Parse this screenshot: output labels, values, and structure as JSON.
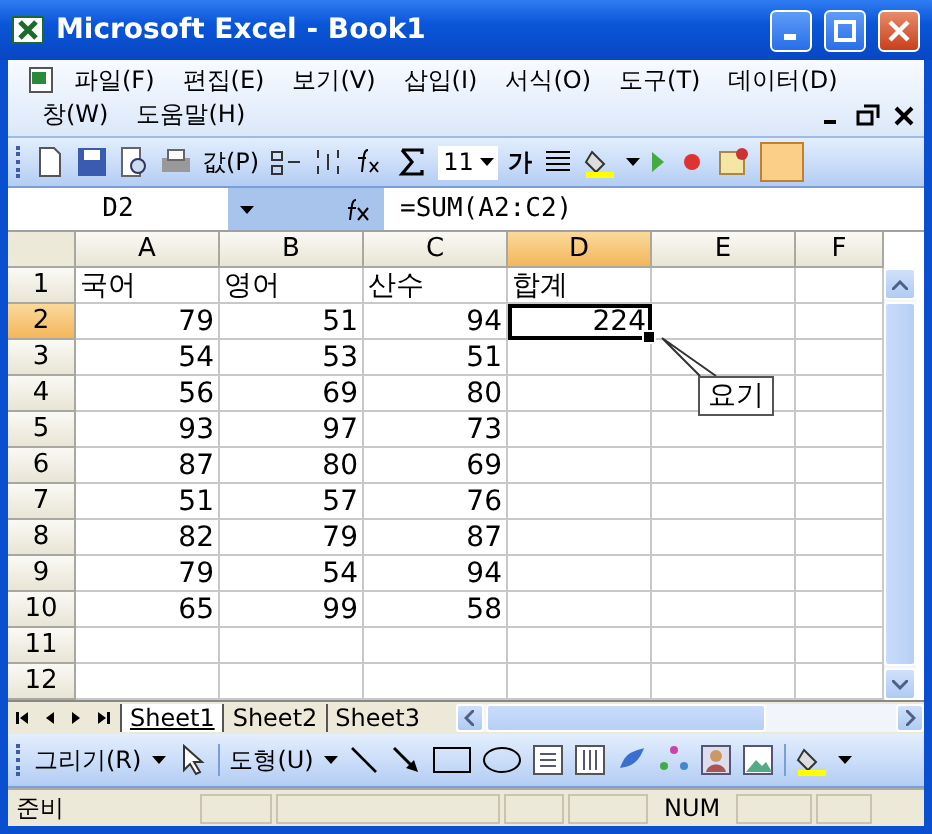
{
  "window": {
    "title": "Microsoft Excel - Book1"
  },
  "menu_rows": [
    [
      "파일(F)",
      "편집(E)",
      "보기(V)",
      "삽입(I)",
      "서식(O)",
      "도구(T)",
      "데이터(D)"
    ],
    [
      "창(W)",
      "도움말(H)"
    ]
  ],
  "toolbar": {
    "paste_label": "값(P)",
    "font_size": "11",
    "bold_label": "가"
  },
  "formula_bar": {
    "name_box": "D2",
    "formula": "=SUM(A2:C2)"
  },
  "sheet": {
    "columns": [
      {
        "label": "A",
        "selected": false
      },
      {
        "label": "B",
        "selected": false
      },
      {
        "label": "C",
        "selected": false
      },
      {
        "label": "D",
        "selected": true
      },
      {
        "label": "E",
        "selected": false
      },
      {
        "label": "F",
        "selected": false
      }
    ],
    "rows": [
      {
        "label": "1",
        "selected": false,
        "cells": [
          {
            "text": "국어",
            "kind": "text",
            "active": false
          },
          {
            "text": "영어",
            "kind": "text",
            "active": false
          },
          {
            "text": "산수",
            "kind": "text",
            "active": false
          },
          {
            "text": "합계",
            "kind": "text",
            "active": false
          },
          {
            "active": false
          },
          {
            "active": false
          }
        ]
      },
      {
        "label": "2",
        "selected": true,
        "cells": [
          {
            "text": "79",
            "kind": "number",
            "active": false
          },
          {
            "text": "51",
            "kind": "number",
            "active": false
          },
          {
            "text": "94",
            "kind": "number",
            "active": false
          },
          {
            "text": "224",
            "kind": "number",
            "active": true
          },
          {
            "active": false
          },
          {
            "active": false
          }
        ]
      },
      {
        "label": "3",
        "selected": false,
        "cells": [
          {
            "text": "54",
            "kind": "number",
            "active": false
          },
          {
            "text": "53",
            "kind": "number",
            "active": false
          },
          {
            "text": "51",
            "kind": "number",
            "active": false
          },
          {
            "active": false
          },
          {
            "active": false
          },
          {
            "active": false
          }
        ]
      },
      {
        "label": "4",
        "selected": false,
        "cells": [
          {
            "text": "56",
            "kind": "number",
            "active": false
          },
          {
            "text": "69",
            "kind": "number",
            "active": false
          },
          {
            "text": "80",
            "kind": "number",
            "active": false
          },
          {
            "active": false
          },
          {
            "active": false
          },
          {
            "active": false
          }
        ]
      },
      {
        "label": "5",
        "selected": false,
        "cells": [
          {
            "text": "93",
            "kind": "number",
            "active": false
          },
          {
            "text": "97",
            "kind": "number",
            "active": false
          },
          {
            "text": "73",
            "kind": "number",
            "active": false
          },
          {
            "active": false
          },
          {
            "active": false
          },
          {
            "active": false
          }
        ]
      },
      {
        "label": "6",
        "selected": false,
        "cells": [
          {
            "text": "87",
            "kind": "number",
            "active": false
          },
          {
            "text": "80",
            "kind": "number",
            "active": false
          },
          {
            "text": "69",
            "kind": "number",
            "active": false
          },
          {
            "active": false
          },
          {
            "active": false
          },
          {
            "active": false
          }
        ]
      },
      {
        "label": "7",
        "selected": false,
        "cells": [
          {
            "text": "51",
            "kind": "number",
            "active": false
          },
          {
            "text": "57",
            "kind": "number",
            "active": false
          },
          {
            "text": "76",
            "kind": "number",
            "active": false
          },
          {
            "active": false
          },
          {
            "active": false
          },
          {
            "active": false
          }
        ]
      },
      {
        "label": "8",
        "selected": false,
        "cells": [
          {
            "text": "82",
            "kind": "number",
            "active": false
          },
          {
            "text": "79",
            "kind": "number",
            "active": false
          },
          {
            "text": "87",
            "kind": "number",
            "active": false
          },
          {
            "active": false
          },
          {
            "active": false
          },
          {
            "active": false
          }
        ]
      },
      {
        "label": "9",
        "selected": false,
        "cells": [
          {
            "text": "79",
            "kind": "number",
            "active": false
          },
          {
            "text": "54",
            "kind": "number",
            "active": false
          },
          {
            "text": "94",
            "kind": "number",
            "active": false
          },
          {
            "active": false
          },
          {
            "active": false
          },
          {
            "active": false
          }
        ]
      },
      {
        "label": "10",
        "selected": false,
        "cells": [
          {
            "text": "65",
            "kind": "number",
            "active": false
          },
          {
            "text": "99",
            "kind": "number",
            "active": false
          },
          {
            "text": "58",
            "kind": "number",
            "active": false
          },
          {
            "active": false
          },
          {
            "active": false
          },
          {
            "active": false
          }
        ]
      },
      {
        "label": "11",
        "selected": false,
        "cells": [
          {
            "active": false
          },
          {
            "active": false
          },
          {
            "active": false
          },
          {
            "active": false
          },
          {
            "active": false
          },
          {
            "active": false
          }
        ]
      },
      {
        "label": "12",
        "selected": false,
        "cells": [
          {
            "active": false
          },
          {
            "active": false
          },
          {
            "active": false
          },
          {
            "active": false
          },
          {
            "active": false
          },
          {
            "active": false
          }
        ]
      }
    ],
    "callout": {
      "text": "요기"
    }
  },
  "sheet_tabs": [
    {
      "label": "Sheet1",
      "selected": true
    },
    {
      "label": "Sheet2",
      "selected": false
    },
    {
      "label": "Sheet3",
      "selected": false
    }
  ],
  "drawing_toolbar": {
    "draw_menu": "그리기(R)",
    "shapes_menu": "도형(U)"
  },
  "status_bar": {
    "mode": "준비",
    "num": "NUM"
  }
}
